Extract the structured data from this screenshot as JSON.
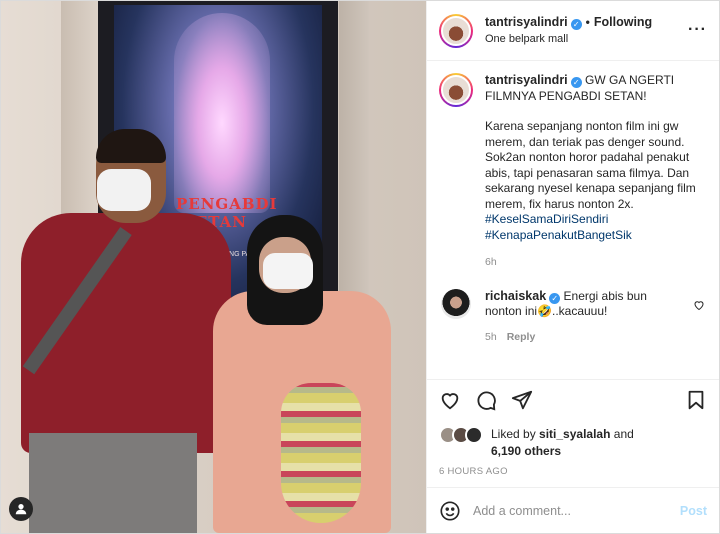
{
  "post": {
    "username": "tantrisyalindri",
    "follow_separator": "•",
    "follow_status": "Following",
    "location": "One belpark mall",
    "more_label": "···"
  },
  "poster": {
    "title_line1": "PENGABDI",
    "title_line2": "SETAN",
    "subtitle": "SENANG PAISA"
  },
  "caption": {
    "username": "tantrisyalindri",
    "headline": "GW GA NGERTI FILMNYA PENGABDI SETAN!",
    "body": "Karena sepanjang nonton film ini gw merem, dan teriak pas denger sound. Sok2an nonton horor padahal penakut abis, tapi penasaran sama filmya. Dan sekarang nyesel kenapa sepanjang film merem, fix harus nonton 2x.",
    "hashtag1": "#KeselSamaDiriSendiri",
    "hashtag2": "#KenapaPenakutBangetSik",
    "time": "6h"
  },
  "comment": {
    "username": "richaiskak",
    "text": "Energi abis bun nonton ini🤣..kacauuu!",
    "time": "5h",
    "reply_label": "Reply"
  },
  "likes": {
    "prefix": "Liked by",
    "user": "siti_syalalah",
    "and": "and",
    "others": "6,190 others"
  },
  "posted_time": "6 HOURS AGO",
  "add_comment": {
    "placeholder": "Add a comment...",
    "post_label": "Post"
  },
  "colors": {
    "link_blue": "#00376b",
    "post_disabled": "#b2dffc",
    "verified": "#3897f0",
    "muted": "#8e8e8e"
  },
  "icons": [
    "tag-user-icon",
    "verified-icon",
    "heart-icon",
    "comment-icon",
    "share-icon",
    "save-icon",
    "emoji-icon"
  ]
}
